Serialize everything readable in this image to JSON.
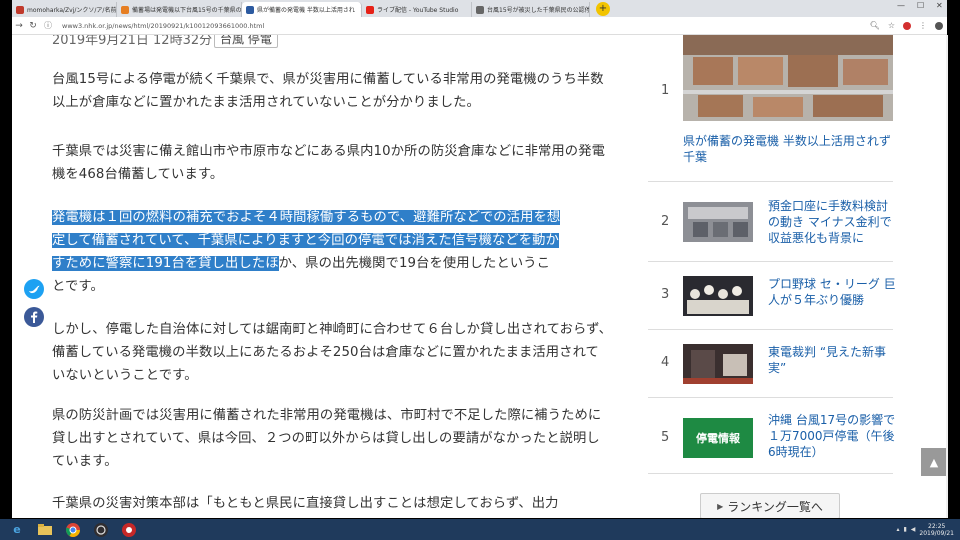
{
  "browser": {
    "tabs": [
      {
        "label": "momoharka/Zvj/ンクソ/ア/名前",
        "color": "#c0392b",
        "active": false
      },
      {
        "label": "備蓄場は発電機以下台風15号の千葉県の活用",
        "color": "#e67e22",
        "active": false
      },
      {
        "label": "県が備蓄の発電機 半数以上活用され",
        "color": "#2c5aa0",
        "active": true
      },
      {
        "label": "ライブ配信 - YouTube Studio",
        "color": "#e62117",
        "active": false
      },
      {
        "label": "台風15号が被災した千葉県民の公認停電",
        "color": "#666666",
        "active": false
      }
    ],
    "url": "www3.nhk.or.jp/news/html/20190921/k10012093661000.html"
  },
  "article": {
    "date": "2019年9月21日 12時32分",
    "tag_button": "台風 停電",
    "paragraphs": [
      "台風15号による停電が続く千葉県で、県が災害用に備蓄している非常用の発電機のうち半数以上が倉庫などに置かれたまま活用されていないことが分かりました。",
      "千葉県では災害に備え館山市や市原市などにある県内10か所の防災倉庫などに非常用の発電機を468台備蓄しています。",
      "しかし、停電した自治体に対しては鋸南町と神崎町に合わせて６台しか貸し出されておらず、備蓄している発電機の半数以上にあたるおよそ250台は倉庫などに置かれたまま活用されていないということです。",
      "県の防災計画では災害用に備蓄された非常用の発電機は、市町村で不足した際に補うために貸し出すとされていて、県は今回、２つの町以外からは貸し出しの要請がなかったと説明しています。",
      "千葉県の災害対策本部は「もともと県民に直接貸し出すことは想定しておらず、出力"
    ],
    "para3_highlight_line1": "発電機は１回の燃料の補充でおよそ４時間稼働するもので、避難所などでの活用を想",
    "para3_highlight_line2": "定して備蓄されていて、千葉県によりますと今回の停電では消えた信号機などを動か",
    "para3_highlight_line3": "すために警察に191台を貸し出したほ",
    "para3_rest_line3": "か、県の出先機関で19台を使用したというこ",
    "para3_line4": "とです。"
  },
  "ranking": {
    "items": [
      {
        "rank": "1",
        "title": "県が備蓄の発電機 半数以上活用されず 千葉"
      },
      {
        "rank": "2",
        "title": "預金口座に手数料検討の動き マイナス金利で収益悪化も背景に"
      },
      {
        "rank": "3",
        "title": "プロ野球 セ・リーグ 巨人が５年ぶり優勝"
      },
      {
        "rank": "4",
        "title": "東電裁判 “見えた新事実”"
      },
      {
        "rank": "5",
        "title": "沖縄 台風17号の影響で１万7000戸停電（午後6時現在）"
      }
    ],
    "thumb5_text": "停電情報",
    "more_label": "ランキング一覧へ"
  },
  "taskbar": {
    "time": "22:25",
    "date": "2019/09/21"
  },
  "colors": {
    "highlight": "#2f7fc9",
    "link": "#1a5fa8",
    "taskbar": "#1f3a5c"
  }
}
